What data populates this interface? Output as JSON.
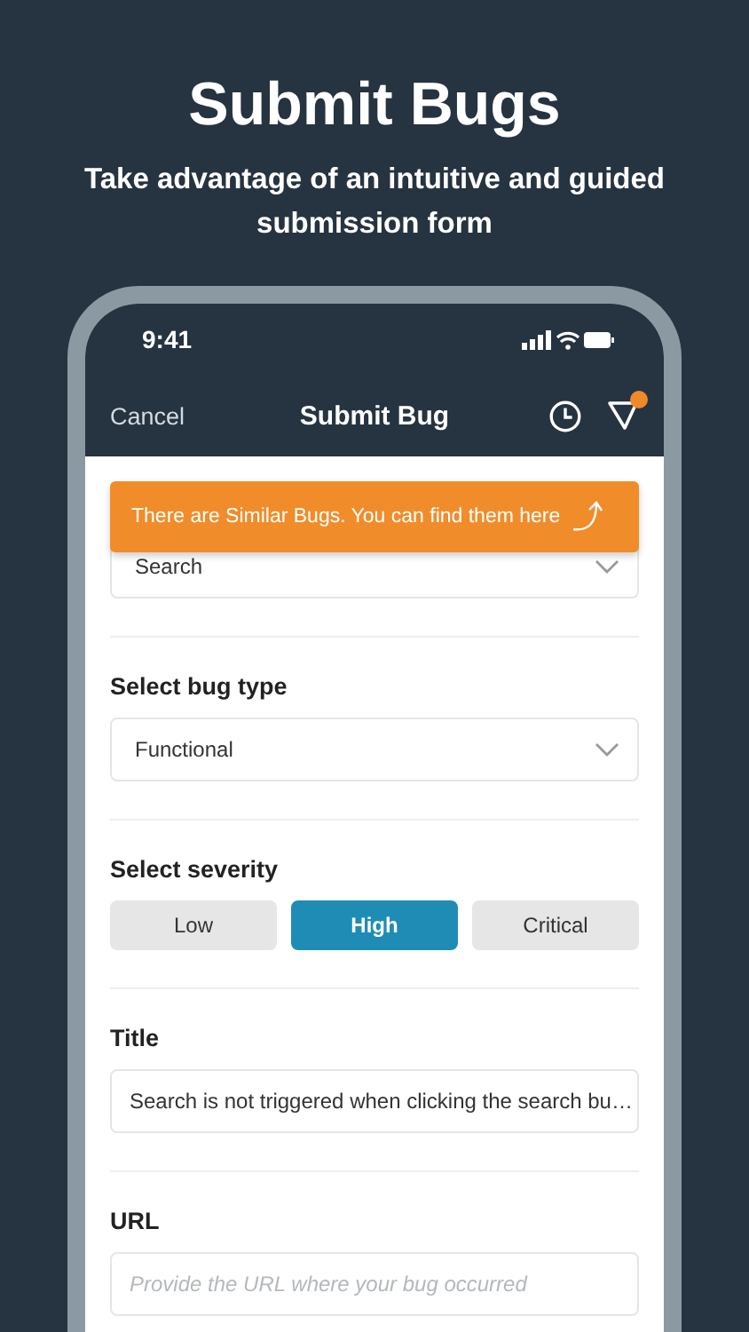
{
  "header": {
    "title": "Submit Bugs",
    "subtitle": "Take advantage of an intuitive and guided submission form"
  },
  "status_bar": {
    "time": "9:41"
  },
  "nav": {
    "cancel": "Cancel",
    "title": "Submit Bug",
    "notification": true
  },
  "tooltip": {
    "text": "There are Similar Bugs. You can find them here"
  },
  "sections": [
    {
      "kind": "select",
      "value": "Search"
    },
    {
      "kind": "select",
      "label": "Select bug type",
      "value": "Functional"
    },
    {
      "kind": "segmented",
      "label": "Select severity",
      "options": [
        {
          "label": "Low",
          "selected": false
        },
        {
          "label": "High",
          "selected": true
        },
        {
          "label": "Critical",
          "selected": false
        }
      ]
    },
    {
      "kind": "input",
      "label": "Title",
      "value": "Search is not triggered when clicking the search bu…"
    },
    {
      "kind": "input",
      "label": "URL",
      "placeholder": "Provide the URL where your bug occurred"
    }
  ]
}
